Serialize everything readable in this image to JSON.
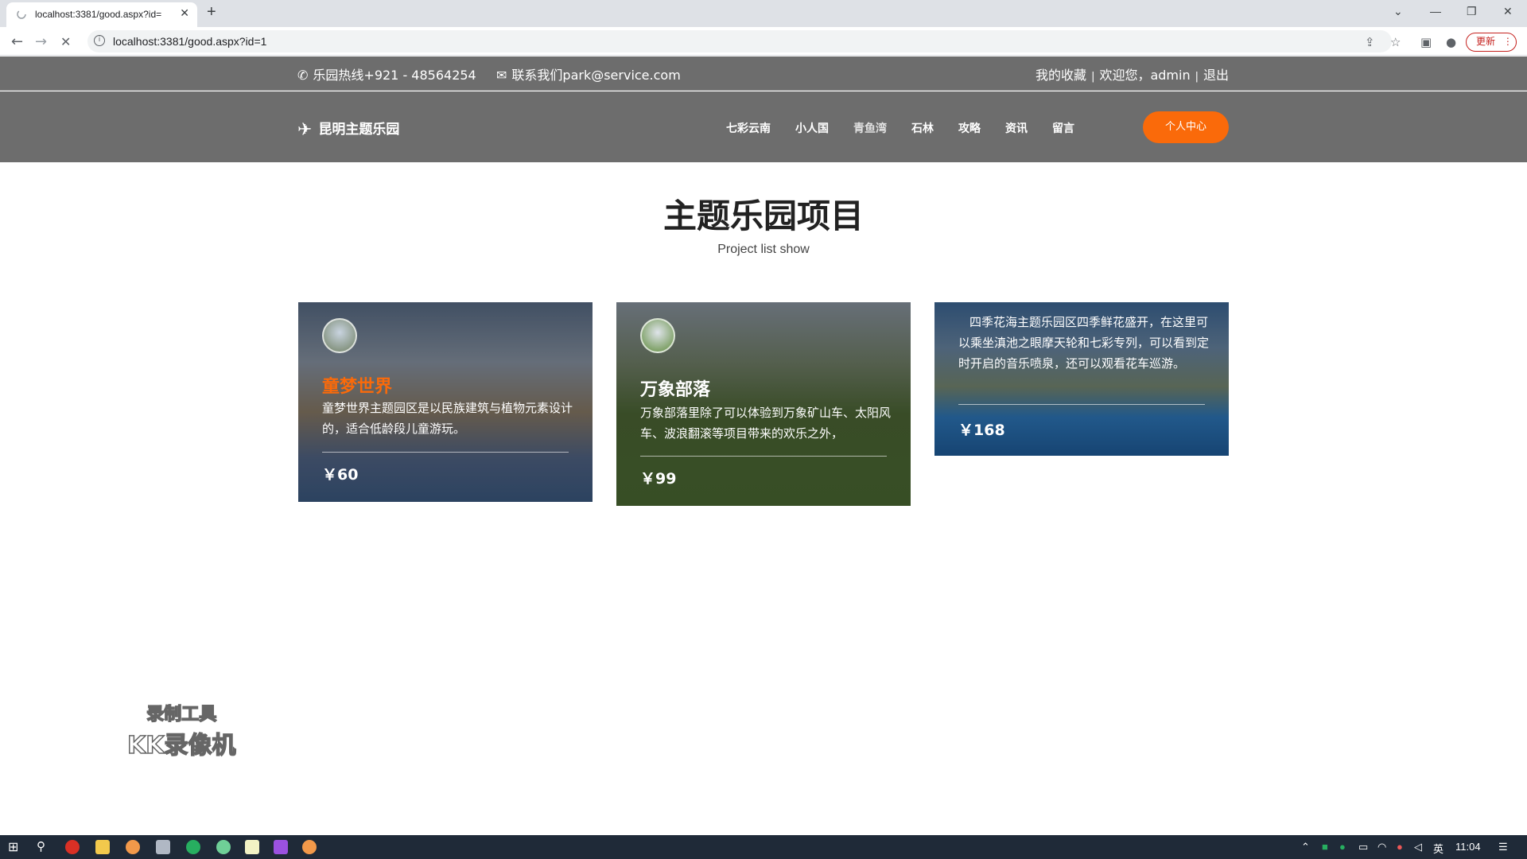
{
  "browser": {
    "tab_title": "localhost:3381/good.aspx?id=",
    "tab_close": "✕",
    "new_tab": "+",
    "url": "localhost:3381/good.aspx?id=1",
    "update_label": "更新",
    "update_menu": "⋮"
  },
  "topbar": {
    "hotline": "乐园热线+921 - 48564254",
    "contact": "联系我们park@service.com",
    "favorites": "我的收藏",
    "welcome": "欢迎您，admin",
    "logout": "退出",
    "sep": "|"
  },
  "header": {
    "logo_text": "昆明主题乐园",
    "nav": [
      "七彩云南",
      "小人国",
      "青鱼湾",
      "石林",
      "攻略",
      "资讯",
      "留言"
    ],
    "cta_label": "个人中心"
  },
  "section": {
    "title": "主题乐园项目",
    "subtitle": "Project list show"
  },
  "cards": [
    {
      "name": "童梦世界",
      "description": "童梦世界主题园区是以民族建筑与植物元素设计的，适合低龄段儿童游玩。",
      "price": "￥60",
      "name_color": "#fa6a0a"
    },
    {
      "name": "万象部落",
      "description": "万象部落里除了可以体验到万象矿山车、太阳风车、波浪翻滚等项目带来的欢乐之外，",
      "price": "￥99",
      "name_color": "#ffffff"
    },
    {
      "name": "",
      "description": "四季花海主题乐园区四季鲜花盛开，在这里可以乘坐滇池之眼摩天轮和七彩专列，可以看到定时开启的音乐喷泉，还可以观看花车巡游。",
      "price": "￥168",
      "name_color": "#ffffff"
    }
  ],
  "watermark": {
    "line1": "录制工具",
    "line2": "KK录像机"
  },
  "taskbar": {
    "ime": "英",
    "clock": "11:04"
  }
}
